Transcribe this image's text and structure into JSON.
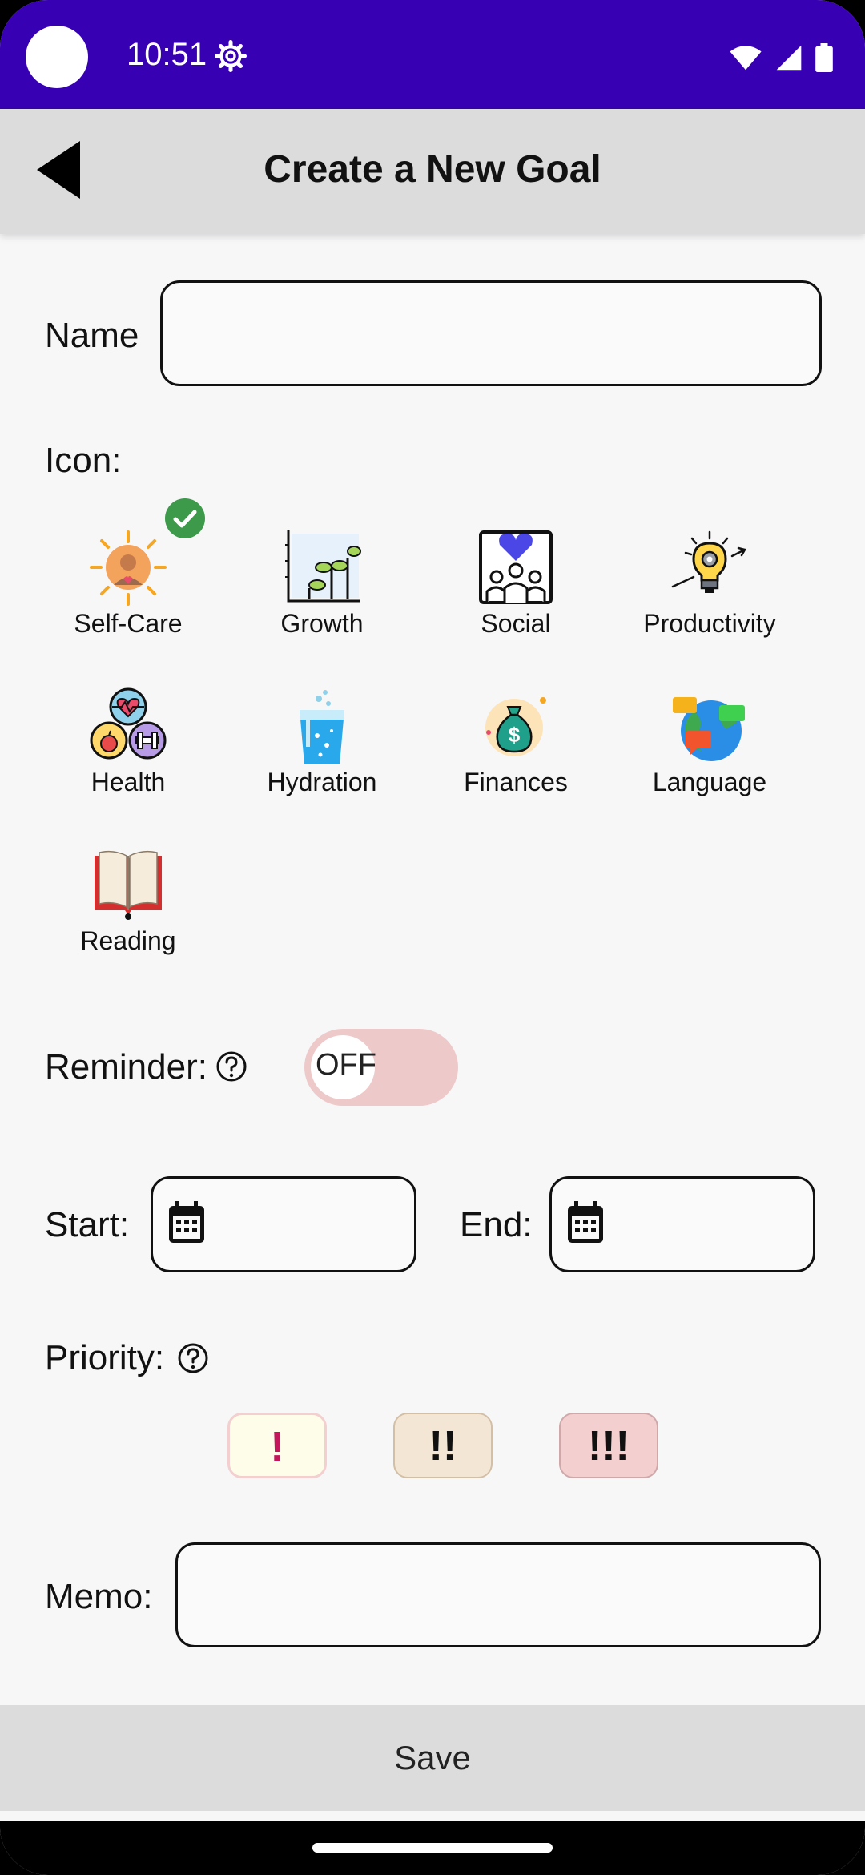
{
  "status_bar": {
    "time": "10:51"
  },
  "toolbar": {
    "title": "Create a New Goal"
  },
  "form": {
    "name_label": "Name",
    "name_value": "",
    "icon_label": "Icon:",
    "icons": [
      {
        "label": "Self-Care",
        "selected": true
      },
      {
        "label": "Growth"
      },
      {
        "label": "Social"
      },
      {
        "label": "Productivity"
      },
      {
        "label": "Health"
      },
      {
        "label": "Hydration"
      },
      {
        "label": "Finances"
      },
      {
        "label": "Language"
      },
      {
        "label": "Reading"
      }
    ],
    "reminder_label": "Reminder:",
    "reminder_state": "OFF",
    "start_label": "Start:",
    "end_label": "End:",
    "priority_label": "Priority:",
    "priorities": [
      "!",
      "!!",
      "!!!"
    ],
    "memo_label": "Memo:",
    "memo_value": ""
  },
  "save_label": "Save",
  "colors": {
    "status_bar": "#3700b3",
    "toolbar": "#dcdcdc",
    "toggle_off": "#eec9c9",
    "check_green": "#3c9a4a",
    "priority_low": "#fdfde9",
    "priority_mid": "#f3e6d4",
    "priority_high": "#f3cfd0"
  }
}
